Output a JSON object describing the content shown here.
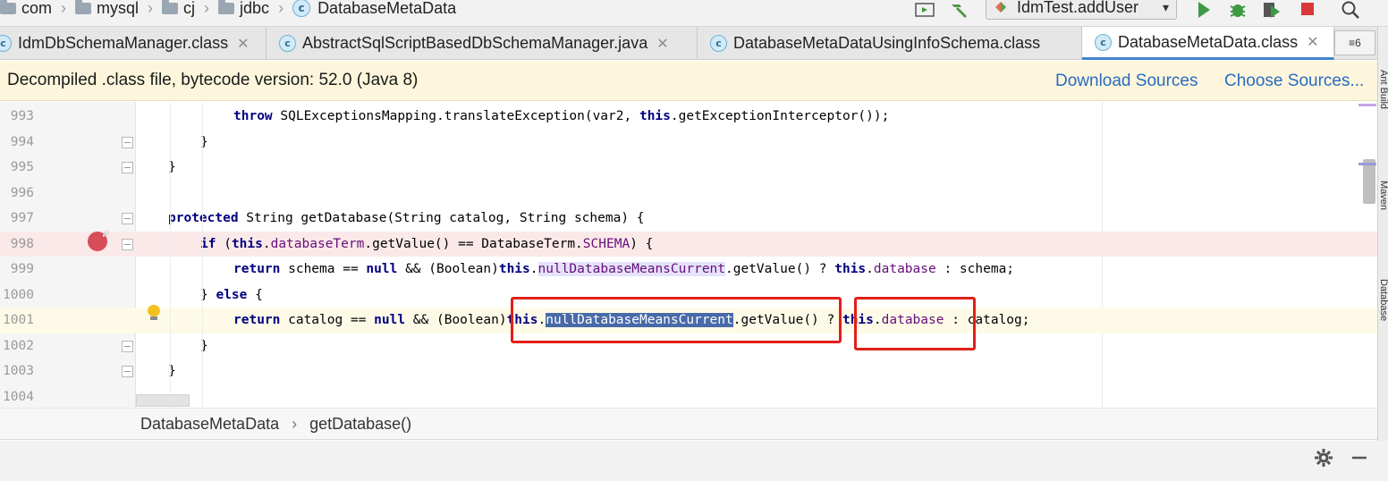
{
  "breadcrumb": [
    "com",
    "mysql",
    "cj",
    "jdbc"
  ],
  "breadcrumb_current": "DatabaseMetaData",
  "run_config": {
    "label": "IdmTest.addUser"
  },
  "tabs": [
    {
      "label": "IdmDbSchemaManager.class",
      "close": "✕"
    },
    {
      "label": "AbstractSqlScriptBasedDbSchemaManager.java",
      "close": "✕"
    },
    {
      "label": "DatabaseMetaDataUsingInfoSchema.class",
      "close": ""
    },
    {
      "label": "DatabaseMetaData.class",
      "close": "✕"
    }
  ],
  "tab_overflow": "≡6",
  "banner": {
    "text": "Decompiled .class file, bytecode version: 52.0 (Java 8)",
    "download_sources": "Download Sources",
    "choose_sources": "Choose Sources..."
  },
  "code_lines": [
    {
      "n": "993"
    },
    {
      "n": "994"
    },
    {
      "n": "995"
    },
    {
      "n": "996"
    },
    {
      "n": "997"
    },
    {
      "n": "998"
    },
    {
      "n": "999"
    },
    {
      "n": "1000"
    },
    {
      "n": "1001"
    },
    {
      "n": "1002"
    },
    {
      "n": "1003"
    },
    {
      "n": "1004"
    }
  ],
  "code_text": {
    "l993_throw": "throw",
    "l993_rest": " SQLExceptionsMapping.translateException(var2, ",
    "l993_this": "this",
    "l993_tail": ".getExceptionInterceptor());",
    "l994": "}",
    "l995": "}",
    "l997_kw": "protected",
    "l997_rest": " String getDatabase(String catalog, String schema) {",
    "l998_if": "if",
    "l998_a": " (",
    "l998_this": "this",
    "l998_dot": ".",
    "l998_field": "databaseTerm",
    "l998_rest": ".getValue() == DatabaseTerm.",
    "l998_const": "SCHEMA",
    "l998_end": ") {",
    "l999_return": "return",
    "l999_a": " schema == ",
    "l999_null": "null",
    "l999_b": " && (Boolean)",
    "l999_this": "this",
    "l999_dot": ".",
    "l999_field": "nullDatabaseMeansCurrent",
    "l999_c": ".getValue() ? ",
    "l999_this2": "this",
    "l999_dot2": ".",
    "l999_field2": "database",
    "l999_end": " : schema;",
    "l1000_brace": "} ",
    "l1000_else": "else",
    "l1000_end": " {",
    "l1001_return": "return",
    "l1001_a": " catalog == ",
    "l1001_null": "null",
    "l1001_b": " && (Boolean)",
    "l1001_this": "this",
    "l1001_dot": ".",
    "l1001_field": "nullDatabaseMeansCurrent",
    "l1001_c": ".getValue() ? ",
    "l1001_this2": "this",
    "l1001_dot2": ".",
    "l1001_field2": "database",
    "l1001_end": " : catalog;",
    "l1002": "}",
    "l1003": "}"
  },
  "status_breadcrumb": {
    "class": "DatabaseMetaData",
    "sep": "›",
    "method": "getDatabase()"
  },
  "right_strip": {
    "label_top": "Ant Build",
    "label_mid": "Maven",
    "label_bottom": "Database"
  },
  "icons": [
    "folder-icon",
    "class-icon",
    "hammer-icon",
    "run-icon",
    "debug-icon",
    "coverage-icon",
    "stop-icon",
    "search-icon",
    "breakpoint-icon",
    "bulb-icon",
    "gear-icon",
    "minimize-icon"
  ],
  "colors": {
    "accent": "#4083c9",
    "annotation": "#e0201a",
    "selection": "#486aa8",
    "banner": "#fdf6dc",
    "link": "#2a6bc2"
  }
}
